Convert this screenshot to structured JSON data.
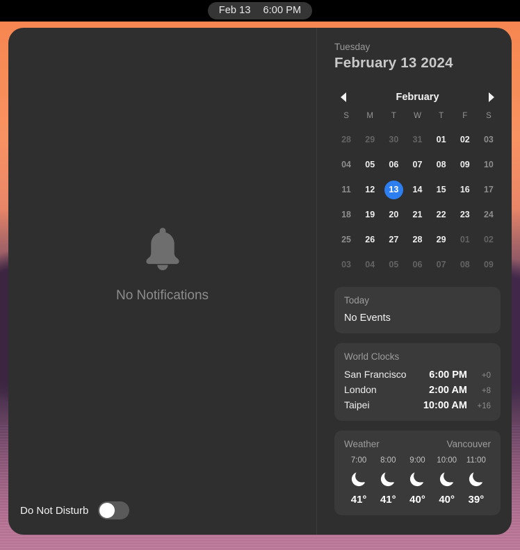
{
  "menubar": {
    "date": "Feb 13",
    "time": "6:00 PM"
  },
  "notifications": {
    "icon": "bell-icon",
    "empty_label": "No Notifications",
    "do_not_disturb_label": "Do Not Disturb",
    "do_not_disturb_on": false
  },
  "header": {
    "weekday": "Tuesday",
    "full_date": "February 13 2024"
  },
  "calendar": {
    "month": "February",
    "prev_icon": "chevron-left-icon",
    "next_icon": "chevron-right-icon",
    "weekdays": [
      "S",
      "M",
      "T",
      "W",
      "T",
      "F",
      "S"
    ],
    "selected_day": "13",
    "accent_color": "#2d7ff0",
    "weeks": [
      [
        {
          "d": "28",
          "t": "other"
        },
        {
          "d": "29",
          "t": "other"
        },
        {
          "d": "30",
          "t": "other"
        },
        {
          "d": "31",
          "t": "other"
        },
        {
          "d": "01",
          "t": "current"
        },
        {
          "d": "02",
          "t": "current"
        },
        {
          "d": "03",
          "t": "weekend"
        }
      ],
      [
        {
          "d": "04",
          "t": "weekend"
        },
        {
          "d": "05",
          "t": "current"
        },
        {
          "d": "06",
          "t": "current"
        },
        {
          "d": "07",
          "t": "current"
        },
        {
          "d": "08",
          "t": "current"
        },
        {
          "d": "09",
          "t": "current"
        },
        {
          "d": "10",
          "t": "weekend"
        }
      ],
      [
        {
          "d": "11",
          "t": "weekend"
        },
        {
          "d": "12",
          "t": "current"
        },
        {
          "d": "13",
          "t": "selected"
        },
        {
          "d": "14",
          "t": "current"
        },
        {
          "d": "15",
          "t": "current"
        },
        {
          "d": "16",
          "t": "current"
        },
        {
          "d": "17",
          "t": "weekend"
        }
      ],
      [
        {
          "d": "18",
          "t": "weekend"
        },
        {
          "d": "19",
          "t": "current"
        },
        {
          "d": "20",
          "t": "current"
        },
        {
          "d": "21",
          "t": "current"
        },
        {
          "d": "22",
          "t": "current"
        },
        {
          "d": "23",
          "t": "current"
        },
        {
          "d": "24",
          "t": "weekend"
        }
      ],
      [
        {
          "d": "25",
          "t": "weekend"
        },
        {
          "d": "26",
          "t": "current"
        },
        {
          "d": "27",
          "t": "current"
        },
        {
          "d": "28",
          "t": "current"
        },
        {
          "d": "29",
          "t": "current"
        },
        {
          "d": "01",
          "t": "other"
        },
        {
          "d": "02",
          "t": "other"
        }
      ],
      [
        {
          "d": "03",
          "t": "other"
        },
        {
          "d": "04",
          "t": "other"
        },
        {
          "d": "05",
          "t": "other"
        },
        {
          "d": "06",
          "t": "other"
        },
        {
          "d": "07",
          "t": "other"
        },
        {
          "d": "08",
          "t": "other"
        },
        {
          "d": "09",
          "t": "other"
        }
      ]
    ]
  },
  "events": {
    "title": "Today",
    "body": "No Events"
  },
  "world_clocks": {
    "title": "World Clocks",
    "rows": [
      {
        "city": "San Francisco",
        "time": "6:00 PM",
        "offset": "+0"
      },
      {
        "city": "London",
        "time": "2:00 AM",
        "offset": "+8"
      },
      {
        "city": "Taipei",
        "time": "10:00 AM",
        "offset": "+16"
      }
    ]
  },
  "weather": {
    "title": "Weather",
    "location": "Vancouver",
    "hours": [
      {
        "hour": "7:00",
        "icon": "moon-icon",
        "temp": "41°"
      },
      {
        "hour": "8:00",
        "icon": "moon-icon",
        "temp": "41°"
      },
      {
        "hour": "9:00",
        "icon": "moon-icon",
        "temp": "40°"
      },
      {
        "hour": "10:00",
        "icon": "moon-icon",
        "temp": "40°"
      },
      {
        "hour": "11:00",
        "icon": "moon-icon",
        "temp": "39°"
      }
    ]
  }
}
